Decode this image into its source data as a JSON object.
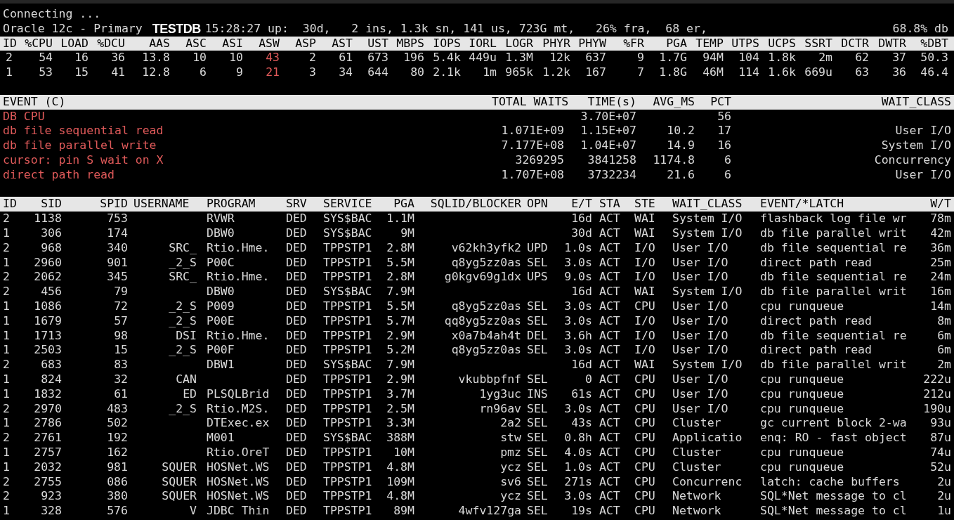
{
  "status": {
    "message": "Connecting ...",
    "product": "Oracle 12c - Primary",
    "database_label": "TESTDB",
    "summary": "15:28:27 up:  30d,   2 ins, 1.3k sn, 141 us, 723G mt,   26% fra,  68 er,",
    "db_share": "68.8% db"
  },
  "instances": {
    "columns": [
      {
        "label": "ID",
        "alert": false
      },
      {
        "label": "%CPU",
        "alert": false
      },
      {
        "label": "LOAD",
        "alert": false
      },
      {
        "label": "%DCU",
        "alert": false
      },
      {
        "label": "AAS",
        "alert": false
      },
      {
        "label": "ASC",
        "alert": false
      },
      {
        "label": "ASI",
        "alert": false
      },
      {
        "label": "ASW",
        "alert": true
      },
      {
        "label": "ASP",
        "alert": false
      },
      {
        "label": "AST",
        "alert": false
      },
      {
        "label": "UST",
        "alert": false
      },
      {
        "label": "MBPS",
        "alert": false
      },
      {
        "label": "IOPS",
        "alert": false
      },
      {
        "label": "IORL",
        "alert": false
      },
      {
        "label": "LOGR",
        "alert": false
      },
      {
        "label": "PHYR",
        "alert": false
      },
      {
        "label": "PHYW",
        "alert": false
      },
      {
        "label": "%FR",
        "alert": false
      },
      {
        "label": "PGA",
        "alert": false
      },
      {
        "label": "TEMP",
        "alert": false
      },
      {
        "label": "UTPS",
        "alert": false
      },
      {
        "label": "UCPS",
        "alert": false
      },
      {
        "label": "SSRT",
        "alert": false
      },
      {
        "label": "DCTR",
        "alert": false
      },
      {
        "label": "DWTR",
        "alert": false
      },
      {
        "label": "%DBT",
        "alert": false
      }
    ],
    "rows": [
      [
        "2",
        "54",
        "16",
        "36",
        "13.8",
        "10",
        "10",
        "43",
        "2",
        "61",
        "673",
        "196",
        "5.4k",
        "449u",
        "1.3M",
        "12k",
        "637",
        "9",
        "1.7G",
        "94M",
        "104",
        "1.8k",
        "2m",
        "62",
        "37",
        "50.3"
      ],
      [
        "1",
        "53",
        "15",
        "41",
        "12.8",
        "6",
        "9",
        "21",
        "3",
        "34",
        "644",
        "80",
        "2.1k",
        "1m",
        "965k",
        "1.2k",
        "167",
        "7",
        "1.8G",
        "46M",
        "114",
        "1.6k",
        "669u",
        "63",
        "36",
        "46.4"
      ]
    ]
  },
  "events": {
    "columns": [
      "EVENT (C)",
      "TOTAL WAITS",
      "TIME(s)",
      "AVG_MS",
      "PCT",
      "WAIT_CLASS"
    ],
    "rows": [
      [
        "DB CPU",
        null,
        "3.70E+07",
        null,
        "56",
        null
      ],
      [
        "db file sequential read",
        "1.071E+09",
        "1.15E+07",
        "10.2",
        "17",
        "User I/O"
      ],
      [
        "db file parallel write",
        "7.177E+08",
        "1.04E+07",
        "14.9",
        "16",
        "System I/O"
      ],
      [
        "cursor: pin S wait on X",
        "3269295",
        "3841258",
        "1174.8",
        "6",
        "Concurrency"
      ],
      [
        "direct path read",
        "1.707E+08",
        "3732234",
        "21.6",
        "6",
        "User I/O"
      ]
    ]
  },
  "sessions": {
    "columns": [
      "ID",
      "SID",
      "SPID",
      "USERNAME",
      "PROGRAM",
      "SRV",
      "SERVICE",
      "PGA",
      "SQLID/BLOCKER",
      "OPN",
      "E/T",
      "STA",
      "STE",
      "WAIT_CLASS",
      "EVENT/*LATCH",
      "W/T"
    ],
    "rows": [
      [
        "2",
        "1138",
        "753",
        null,
        "RVWR",
        "DED",
        "SYS$BAC",
        "1.1M",
        null,
        null,
        "16d",
        "ACT",
        "WAI",
        "System I/O",
        "flashback log file wr",
        "78m"
      ],
      [
        "1",
        "306",
        "174",
        null,
        "DBW0",
        "DED",
        "SYS$BAC",
        "9M",
        null,
        null,
        "30d",
        "ACT",
        "WAI",
        "System I/O",
        "db file parallel writ",
        "42m"
      ],
      [
        "2",
        "968",
        "340",
        "SRC_",
        "Rtio.Hme.",
        "DED",
        "TPPSTP1",
        "2.8M",
        "v62kh3yfk2",
        "UPD",
        "1.0s",
        "ACT",
        "I/O",
        "User I/O",
        "db file sequential re",
        "36m"
      ],
      [
        "1",
        "2960",
        "901",
        "_2_S",
        "P00C",
        "DED",
        "TPPSTP1",
        "5.5M",
        "q8yg5zz0as",
        "SEL",
        "3.0s",
        "ACT",
        "I/O",
        "User I/O",
        "direct path read",
        "25m"
      ],
      [
        "2",
        "2062",
        "345",
        "SRC_",
        "Rtio.Hme.",
        "DED",
        "TPPSTP1",
        "2.8M",
        "g0kgv69g1dx",
        "UPS",
        "9.0s",
        "ACT",
        "I/O",
        "User I/O",
        "db file sequential re",
        "24m"
      ],
      [
        "2",
        "456",
        "79",
        null,
        "DBW0",
        "DED",
        "SYS$BAC",
        "7.9M",
        null,
        null,
        "16d",
        "ACT",
        "WAI",
        "System I/O",
        "db file parallel writ",
        "16m"
      ],
      [
        "1",
        "1086",
        "72",
        "_2_S",
        "P009",
        "DED",
        "TPPSTP1",
        "5.5M",
        "q8yg5zz0as",
        "SEL",
        "3.0s",
        "ACT",
        "CPU",
        "User I/O",
        "cpu runqueue",
        "14m"
      ],
      [
        "1",
        "1679",
        "57",
        "_2_S",
        "P00E",
        "DED",
        "TPPSTP1",
        "5.7M",
        "qq8yg5zz0as",
        "SEL",
        "3.0s",
        "ACT",
        "I/O",
        "User I/O",
        "direct path read",
        "8m"
      ],
      [
        "1",
        "1713",
        "98",
        "DSI",
        "Rtio.Hme.",
        "DED",
        "TPPSTP1",
        "2.9M",
        "x0a7b4ah4t",
        "DEL",
        "3.6h",
        "ACT",
        "I/O",
        "User I/O",
        "db file sequential re",
        "6m"
      ],
      [
        "1",
        "2503",
        "15",
        "_2_S",
        "P00F",
        "DED",
        "TPPSTP1",
        "5.2M",
        "q8yg5zz0as",
        "SEL",
        "3.0s",
        "ACT",
        "I/O",
        "User I/O",
        "direct path read",
        "6m"
      ],
      [
        "2",
        "683",
        "83",
        null,
        "DBW1",
        "DED",
        "SYS$BAC",
        "7.9M",
        null,
        null,
        "16d",
        "ACT",
        "WAI",
        "System I/O",
        "db file parallel writ",
        "2m"
      ],
      [
        "1",
        "824",
        "32",
        "CAN",
        null,
        "DED",
        "TPPSTP1",
        "2.9M",
        "vkubbpfnf",
        "SEL",
        "0",
        "ACT",
        "CPU",
        "User I/O",
        "cpu runqueue",
        "222u"
      ],
      [
        "1",
        "1832",
        "61",
        "ED",
        "PLSQLBrid",
        "DED",
        "TPPSTP1",
        "3.7M",
        "1yg3uc",
        "INS",
        "61s",
        "ACT",
        "CPU",
        "User I/O",
        "cpu runqueue",
        "212u"
      ],
      [
        "2",
        "2970",
        "483",
        "_2_S",
        "Rtio.M2S.",
        "DED",
        "TPPSTP1",
        "2.5M",
        "rn96av",
        "SEL",
        "3.0s",
        "ACT",
        "CPU",
        "User I/O",
        "cpu runqueue",
        "190u"
      ],
      [
        "1",
        "2786",
        "502",
        null,
        "DTExec.ex",
        "DED",
        "TPPSTP1",
        "3.3M",
        "2a2",
        "SEL",
        "43s",
        "ACT",
        "CPU",
        "Cluster",
        "gc current block 2-wa",
        "93u"
      ],
      [
        "2",
        "2761",
        "192",
        null,
        "M001",
        "DED",
        "SYS$BAC",
        "388M",
        "stw",
        "SEL",
        "0.8h",
        "ACT",
        "CPU",
        "Applicatio",
        "enq: RO - fast object",
        "87u"
      ],
      [
        "1",
        "2757",
        "162",
        null,
        "Rtio.OreT",
        "DED",
        "TPPSTP1",
        "10M",
        "pmz",
        "SEL",
        "4.0s",
        "ACT",
        "CPU",
        "Cluster",
        "cpu runqueue",
        "74u"
      ],
      [
        "1",
        "2032",
        "981",
        "SQUER",
        "HOSNet.WS",
        "DED",
        "TPPSTP1",
        "4.8M",
        "ycz",
        "SEL",
        "1.0s",
        "ACT",
        "CPU",
        "Cluster",
        "cpu runqueue",
        "52u"
      ],
      [
        "2",
        "2755",
        "086",
        "SQUER",
        "HOSNet.WS",
        "DED",
        "TPPSTP1",
        "109M",
        "sv6",
        "SEL",
        "271s",
        "ACT",
        "CPU",
        "Concurrenc",
        "latch: cache buffers",
        "2u"
      ],
      [
        "2",
        "923",
        "380",
        "SQUER",
        "HOSNet.WS",
        "DED",
        "TPPSTP1",
        "4.8M",
        "ycz",
        "SEL",
        "3.0s",
        "ACT",
        "CPU",
        "Network",
        "SQL*Net message to cl",
        "2u"
      ],
      [
        "1",
        "328",
        "576",
        "V",
        "JDBC Thin",
        "DED",
        "TPPSTP1",
        "89M",
        "4wfv127ga",
        "SEL",
        "19s",
        "ACT",
        "CPU",
        "Network",
        "SQL*Net message to cl",
        "1u"
      ]
    ]
  }
}
